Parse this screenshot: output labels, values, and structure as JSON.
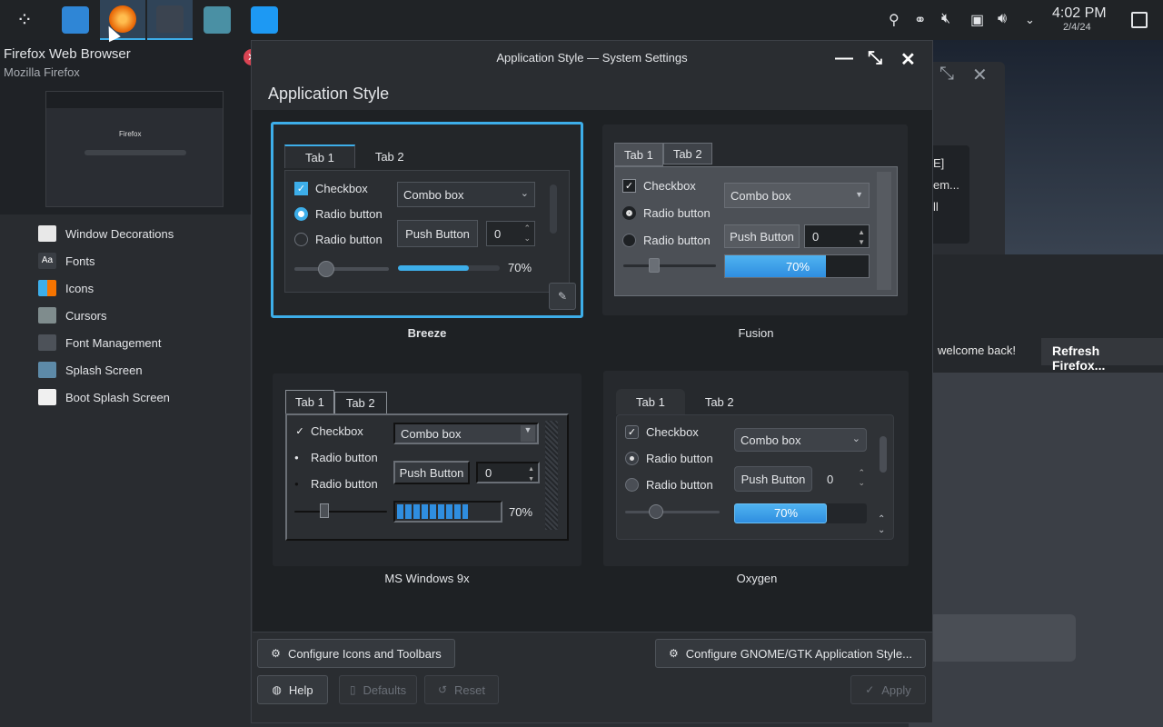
{
  "taskbar": {
    "launcher_icon": "kde-application-launcher-icon",
    "apps": [
      {
        "name": "file-manager-icon",
        "color": "#2f86d6"
      },
      {
        "name": "firefox-icon",
        "color": "#e66000"
      },
      {
        "name": "system-settings-icon",
        "color": "#3b4450"
      },
      {
        "name": "kate-icon",
        "color": "#4a90a4"
      },
      {
        "name": "discover-icon",
        "color": "#1d99f3"
      }
    ],
    "tray_icons": [
      "user-icon",
      "network-icon",
      "muted-speaker-icon",
      "device-icon",
      "volume-icon",
      "chevron-down-icon"
    ],
    "time": "4:02 PM",
    "date": "2/4/24"
  },
  "tooltip": {
    "title": "Firefox Web Browser",
    "subtitle": "Mozilla Firefox",
    "thumb_label": "Firefox"
  },
  "background": {
    "welcome": "welcome back!",
    "refresh_button": "Refresh Firefox...",
    "frag_line1": "E]",
    "frag_line2": "em...",
    "frag_line3": "ll"
  },
  "sidebar": {
    "items": [
      {
        "label": "Window Decorations",
        "icon": "window-decorations-icon"
      },
      {
        "label": "Fonts",
        "icon": "fonts-icon"
      },
      {
        "label": "Icons",
        "icon": "icons-icon"
      },
      {
        "label": "Cursors",
        "icon": "cursors-icon"
      },
      {
        "label": "Font Management",
        "icon": "font-management-icon"
      },
      {
        "label": "Splash Screen",
        "icon": "splash-screen-icon"
      },
      {
        "label": "Boot Splash Screen",
        "icon": "boot-splash-screen-icon"
      }
    ]
  },
  "window": {
    "title": "Application Style — System Settings",
    "page_title": "Application Style",
    "accent": "#3daee9"
  },
  "styles": [
    {
      "name": "Breeze",
      "selected": true
    },
    {
      "name": "Fusion",
      "selected": false
    },
    {
      "name": "MS Windows 9x",
      "selected": false
    },
    {
      "name": "Oxygen",
      "selected": false
    }
  ],
  "preview": {
    "tab1": "Tab 1",
    "tab2": "Tab 2",
    "checkbox": "Checkbox",
    "radio": "Radio button",
    "combo": "Combo box",
    "push": "Push Button",
    "spin_value": "0",
    "progress_text": "70%",
    "progress": 0.7
  },
  "buttons": {
    "configure_icons": "Configure Icons and Toolbars",
    "configure_gtk": "Configure GNOME/GTK Application Style...",
    "help": "Help",
    "defaults": "Defaults",
    "reset": "Reset",
    "apply": "Apply"
  }
}
